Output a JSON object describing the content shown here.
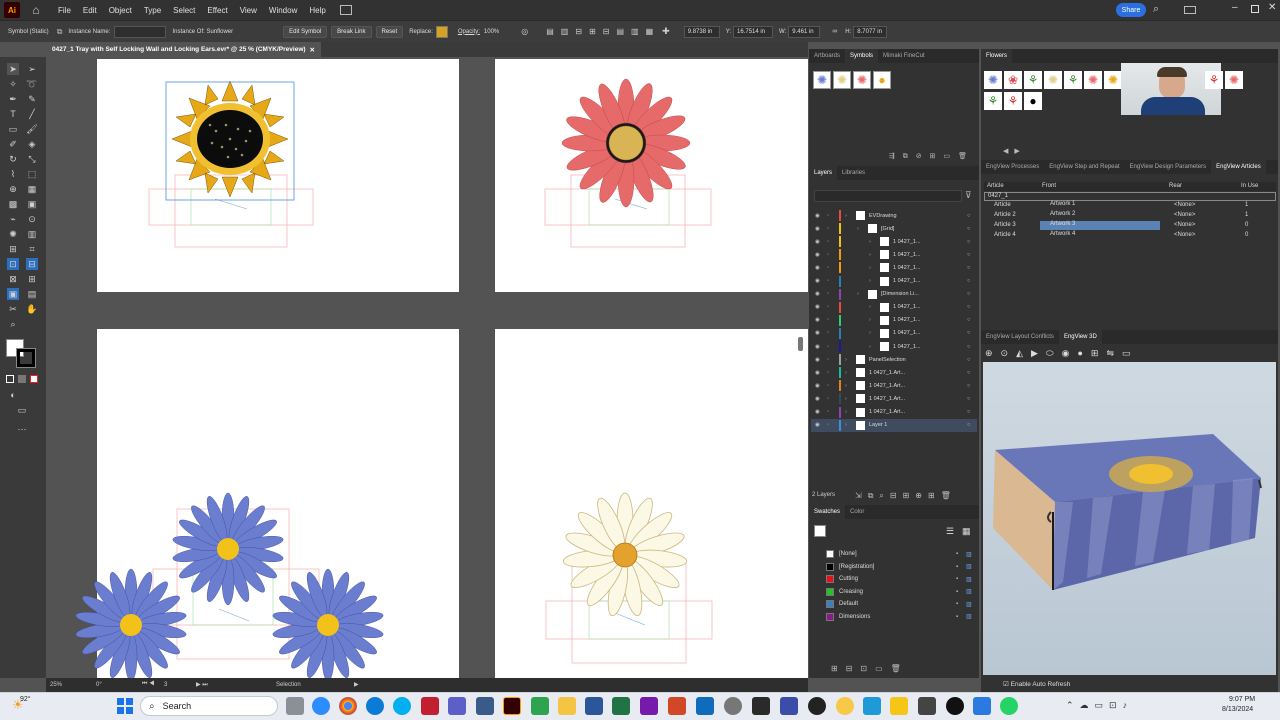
{
  "app": {
    "logo": "Ai"
  },
  "menu": [
    "File",
    "Edit",
    "Object",
    "Type",
    "Select",
    "Effect",
    "View",
    "Window",
    "Help"
  ],
  "share_label": "Share",
  "control": {
    "selection_type": "Symbol (Static)",
    "instance_name_label": "Instance Name:",
    "instance_of": "Instance Of: Sunflower",
    "edit_symbol": "Edit Symbol",
    "break_link": "Break Link",
    "reset": "Reset",
    "replace_label": "Replace:",
    "opacity_label": "Opacity:",
    "opacity_value": "100%",
    "x_value": "9.8738 in",
    "y_label": "Y:",
    "y_value": "16.7514 in",
    "w_label": "W:",
    "w_value": "9.461 in",
    "h_label": "H:",
    "h_value": "8.7077 in"
  },
  "document_tab": "0427_1 Tray with Self Locking Wall and Locking Ears.evr* @ 25 % (CMYK/Preview)",
  "status": {
    "zoom": "25%",
    "rotation": "0°",
    "artboard": "3",
    "tool": "Selection"
  },
  "symbols_panel": {
    "tabs": [
      "Artboards",
      "Symbols",
      "Mimaki FineCut"
    ],
    "active": "Symbols"
  },
  "flowers_panel": {
    "title": "Flowers"
  },
  "layers_panel": {
    "tabs": [
      "Layers",
      "Libraries"
    ],
    "rows": [
      "EVDrawing",
      "[Grid]",
      "1 0427_1...",
      "1 0427_1...",
      "1 0427_1...",
      "1 0427_1...",
      "[Dimension Li...",
      "1 0427_1...",
      "1 0427_1...",
      "1 0427_1...",
      "1 0427_1...",
      "PanelSelection",
      "1 0427_1.Art...",
      "1 0427_1.Art...",
      "1 0427_1.Art...",
      "1 0427_1.Art...",
      "Layer 1"
    ],
    "count": "2 Layers"
  },
  "swatches_panel": {
    "tabs": [
      "Swatches",
      "Color"
    ],
    "items": [
      "[None]",
      "[Registration]",
      "Cutting",
      "Creasing",
      "Default",
      "Dimensions"
    ],
    "colors": [
      "#ffffff",
      "#000000",
      "#e8101c",
      "#22c422",
      "#3c7fbf",
      "#8a1a8a"
    ]
  },
  "engview_articles": {
    "tabs": [
      "EngView Processes",
      "EngView Step and Repeat",
      "EngView Design Parameters",
      "EngView Articles"
    ],
    "active": "EngView Articles",
    "headers": [
      "Article",
      "Front",
      "Rear",
      "In Use"
    ],
    "group": "0427_1",
    "rows": [
      {
        "article": "Article",
        "front": "Artwork 1",
        "rear": "<None>",
        "in_use": "1"
      },
      {
        "article": "Article 2",
        "front": "Artwork 2",
        "rear": "<None>",
        "in_use": "1"
      },
      {
        "article": "Article 3",
        "front": "Artwork 3",
        "rear": "<None>",
        "in_use": "0"
      },
      {
        "article": "Article 4",
        "front": "Artwork 4",
        "rear": "<None>",
        "in_use": "0"
      }
    ]
  },
  "engview_3d": {
    "tabs": [
      "EngView Layout Conflicts",
      "EngView 3D"
    ],
    "active": "EngView 3D",
    "auto_refresh": "Enable Auto Refresh"
  },
  "taskbar": {
    "weather": "92°",
    "search_placeholder": "Search",
    "time": "9:07 PM",
    "date": "8/13/2024"
  }
}
